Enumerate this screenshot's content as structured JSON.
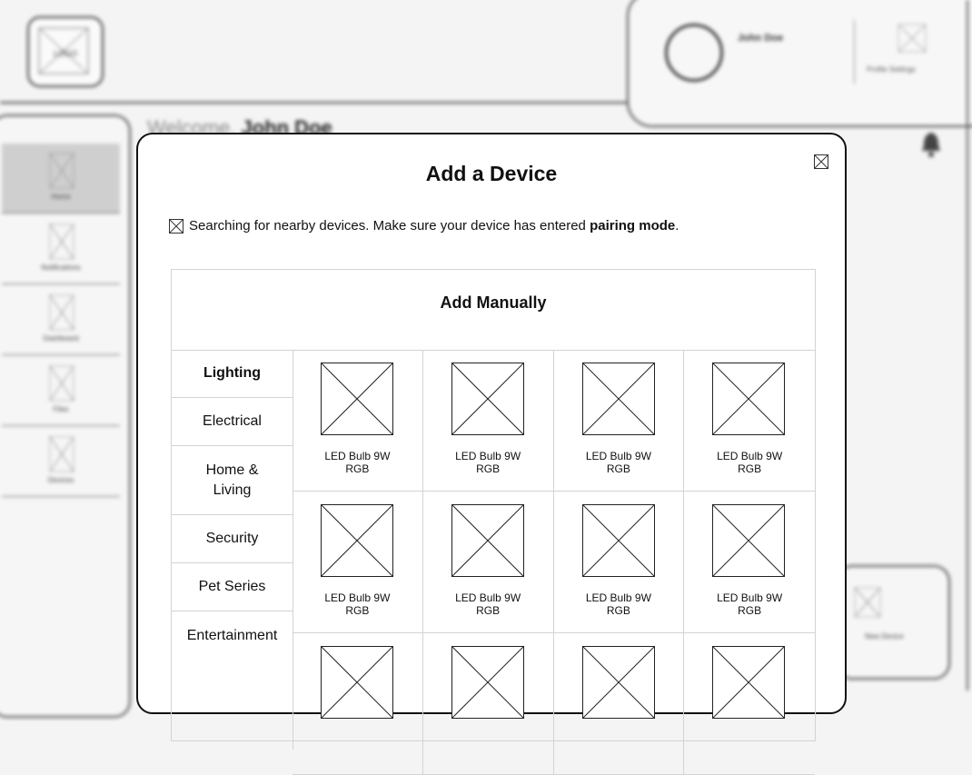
{
  "header": {
    "logo_text": "LOGO",
    "user_name": "John Doe",
    "profile_settings_label": "Profile Settings"
  },
  "sidebar": {
    "items": [
      {
        "label": "Home",
        "active": true
      },
      {
        "label": "Notifications"
      },
      {
        "label": "Dashboard"
      },
      {
        "label": "Files"
      },
      {
        "label": "Devices"
      }
    ]
  },
  "main": {
    "welcome_prefix": "Welcome, ",
    "welcome_name": "John Doe",
    "new_device_label": "New Device"
  },
  "modal": {
    "title": "Add a Device",
    "search_text": "Searching for nearby devices. Make sure your device has entered ",
    "search_emphasis": "pairing mode",
    "search_suffix": ".",
    "manual_title": "Add Manually",
    "categories": [
      {
        "label": "Lighting",
        "active": true
      },
      {
        "label": "Electrical"
      },
      {
        "label": "Home & Living"
      },
      {
        "label": "Security"
      },
      {
        "label": "Pet Series"
      },
      {
        "label": "Entertainment"
      }
    ],
    "devices": [
      {
        "label": "LED Bulb 9W\nRGB"
      },
      {
        "label": "LED Bulb 9W\nRGB"
      },
      {
        "label": "LED Bulb 9W\nRGB"
      },
      {
        "label": "LED Bulb 9W\nRGB"
      },
      {
        "label": "LED Bulb 9W\nRGB"
      },
      {
        "label": "LED Bulb 9W\nRGB"
      },
      {
        "label": "LED Bulb 9W\nRGB"
      },
      {
        "label": "LED Bulb 9W\nRGB"
      },
      {
        "label": ""
      },
      {
        "label": ""
      },
      {
        "label": ""
      },
      {
        "label": ""
      }
    ]
  },
  "icons": {
    "close": "close-icon",
    "search": "search-status-icon",
    "placeholder": "image-placeholder-icon",
    "bell": "bell-icon"
  }
}
